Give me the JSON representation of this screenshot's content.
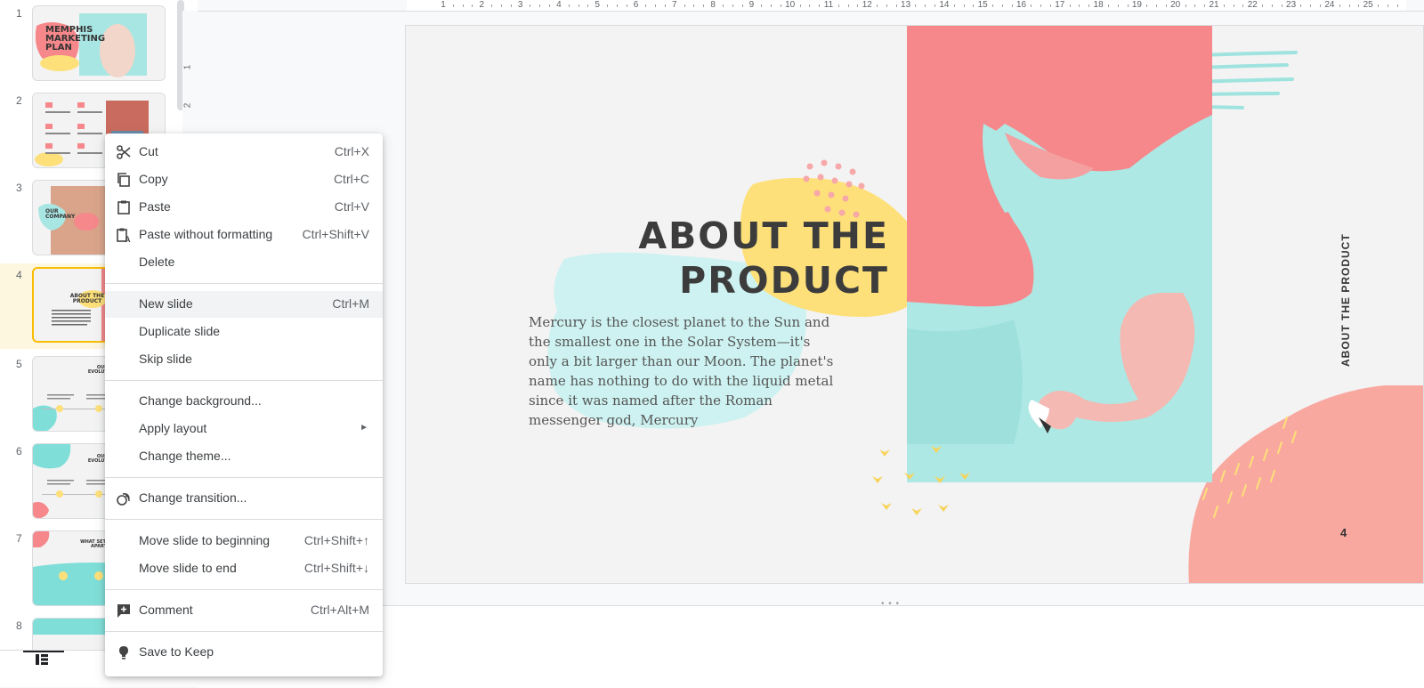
{
  "filmstrip": {
    "slides": [
      {
        "number": "1",
        "title": "MEMPHIS MARKETING PLAN"
      },
      {
        "number": "2"
      },
      {
        "number": "3",
        "title": "OUR COMPANY"
      },
      {
        "number": "4",
        "title": "ABOUT THE PRODUCT"
      },
      {
        "number": "5",
        "title": "OUR EVOLUTION"
      },
      {
        "number": "6",
        "title": "OUR EVOLUTION"
      },
      {
        "number": "7",
        "title": "WHAT SETS US APART"
      },
      {
        "number": "8"
      }
    ]
  },
  "ruler": {
    "top_numbers": [
      "1",
      "2",
      "3",
      "4",
      "5",
      "6",
      "7",
      "8",
      "9",
      "10",
      "11",
      "12",
      "13",
      "14",
      "15",
      "16",
      "17",
      "18",
      "19",
      "20",
      "21",
      "22",
      "23",
      "24",
      "25"
    ],
    "left_numbers": [
      "1",
      "2"
    ]
  },
  "slide": {
    "title_line1": "ABOUT THE",
    "title_line2": "PRODUCT",
    "body": "Mercury is the closest planet to the Sun and the smallest one in the Solar System—it's only a bit larger than our Moon. The planet's name has nothing to do with the liquid metal since it was named after the Roman messenger god, Mercury",
    "vertical_title": "ABOUT THE PRODUCT",
    "page_number": "4"
  },
  "context_menu": {
    "items": [
      {
        "label": "Cut",
        "shortcut": "Ctrl+X",
        "icon": "scissors-icon"
      },
      {
        "label": "Copy",
        "shortcut": "Ctrl+C",
        "icon": "copy-icon"
      },
      {
        "label": "Paste",
        "shortcut": "Ctrl+V",
        "icon": "clipboard-icon"
      },
      {
        "label": "Paste without formatting",
        "shortcut": "Ctrl+Shift+V",
        "icon": "paste-plain-icon"
      },
      {
        "label": "Delete",
        "shortcut": ""
      },
      {
        "label": "New slide",
        "shortcut": "Ctrl+M"
      },
      {
        "label": "Duplicate slide",
        "shortcut": ""
      },
      {
        "label": "Skip slide",
        "shortcut": ""
      },
      {
        "label": "Change background...",
        "shortcut": ""
      },
      {
        "label": "Apply layout",
        "shortcut": "",
        "submenu": "►"
      },
      {
        "label": "Change theme...",
        "shortcut": ""
      },
      {
        "label": "Change transition...",
        "shortcut": "",
        "icon": "transition-icon"
      },
      {
        "label": "Move slide to beginning",
        "shortcut": "Ctrl+Shift+↑"
      },
      {
        "label": "Move slide to end",
        "shortcut": "Ctrl+Shift+↓"
      },
      {
        "label": "Comment",
        "shortcut": "Ctrl+Alt+M",
        "icon": "add-comment-icon"
      },
      {
        "label": "Save to Keep",
        "shortcut": "",
        "icon": "lightbulb-icon"
      }
    ]
  },
  "colors": {
    "coral": "#f6878a",
    "mint": "#a8e6e3",
    "yellow": "#fde07a",
    "selection": "#fbbc04"
  }
}
